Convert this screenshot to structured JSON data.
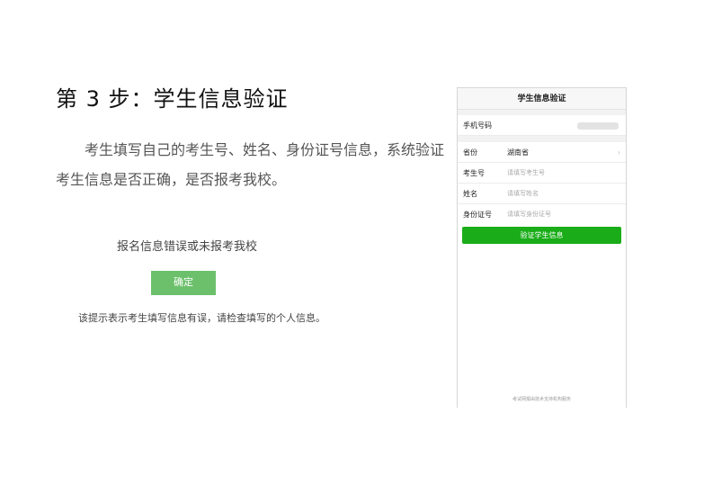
{
  "heading": "第 3 步：学生信息验证",
  "paragraph": "考生填写自己的考生号、姓名、身份证号信息，系统验证考生信息是否正确，是否报考我校。",
  "error_dialog": {
    "message": "报名信息错误或未报考我校",
    "confirm_label": "确定"
  },
  "caption": "该提示表示考生填写信息有误，请检查填写的个人信息。",
  "phone": {
    "title": "学生信息验证",
    "phone_label": "手机号码",
    "province_label": "省份",
    "province_value": "湖南省",
    "exam_no_label": "考生号",
    "exam_no_placeholder": "请填写考生号",
    "name_label": "姓名",
    "name_placeholder": "请填写姓名",
    "id_label": "身份证号",
    "id_placeholder": "请填写身份证号",
    "verify_label": "验证学生信息",
    "footer": "考试网报由技术支持机构服务",
    "arrow": "›"
  },
  "colors": {
    "verify_button": "#1aad19",
    "confirm_button": "#6cc06c"
  }
}
